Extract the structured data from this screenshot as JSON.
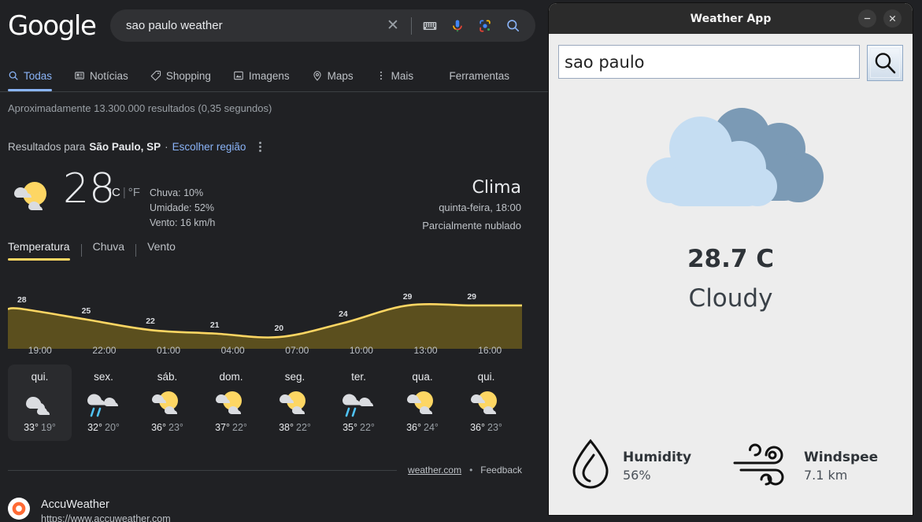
{
  "google": {
    "logo": "Google",
    "search": {
      "query": "sao paulo weather",
      "clear_icon": "close-icon"
    },
    "search_icons": [
      "keyboard-icon",
      "microphone-icon",
      "google-lens-icon",
      "search-icon"
    ],
    "nav": [
      {
        "label": "Todas",
        "icon": "search-icon",
        "active": true
      },
      {
        "label": "Notícias",
        "icon": "news-icon",
        "active": false
      },
      {
        "label": "Shopping",
        "icon": "tag-icon",
        "active": false
      },
      {
        "label": "Imagens",
        "icon": "image-icon",
        "active": false
      },
      {
        "label": "Maps",
        "icon": "map-pin-icon",
        "active": false
      },
      {
        "label": "Mais",
        "icon": "more-vertical-icon",
        "active": false
      }
    ],
    "tools_label": "Ferramentas",
    "result_stats": "Aproximadamente 13.300.000 resultados (0,35 segundos)",
    "region": {
      "prefix": "Resultados para",
      "location": "São Paulo, SP",
      "separator": "·",
      "change_link": "Escolher região"
    },
    "weather_card": {
      "temperature": "28",
      "unit_c": "°C",
      "unit_f": "°F",
      "details": [
        "Chuva: 10%",
        "Umidade: 52%",
        "Vento: 16 km/h"
      ],
      "title": "Clima",
      "datetime": "quinta-feira, 18:00",
      "condition": "Parcialmente nublado",
      "tabs": [
        {
          "label": "Temperatura",
          "active": true
        },
        {
          "label": "Chuva",
          "active": false
        },
        {
          "label": "Vento",
          "active": false
        }
      ],
      "days": [
        {
          "name": "qui.",
          "icon": "cloudy-icon",
          "high": "33°",
          "low": "19°",
          "selected": true
        },
        {
          "name": "sex.",
          "icon": "rain-cloud-icon",
          "high": "32°",
          "low": "20°",
          "selected": false
        },
        {
          "name": "sáb.",
          "icon": "partly-cloudy-icon",
          "high": "36°",
          "low": "23°",
          "selected": false
        },
        {
          "name": "dom.",
          "icon": "partly-cloudy-icon",
          "high": "37°",
          "low": "22°",
          "selected": false
        },
        {
          "name": "seg.",
          "icon": "partly-cloudy-icon",
          "high": "38°",
          "low": "22°",
          "selected": false
        },
        {
          "name": "ter.",
          "icon": "rain-cloud-icon",
          "high": "35°",
          "low": "22°",
          "selected": false
        },
        {
          "name": "qua.",
          "icon": "partly-cloudy-icon",
          "high": "36°",
          "low": "24°",
          "selected": false
        },
        {
          "name": "qui.",
          "icon": "partly-cloudy-icon",
          "high": "36°",
          "low": "23°",
          "selected": false
        }
      ],
      "source_link": "weather.com",
      "source_dot": "•",
      "feedback": "Feedback"
    },
    "organic_result": {
      "title": "AccuWeather",
      "url": "https://www.accuweather.com"
    }
  },
  "chart_data": {
    "type": "line",
    "title": "Temperatura",
    "xlabel": "",
    "ylabel": "",
    "categories": [
      "19:00",
      "22:00",
      "01:00",
      "04:00",
      "07:00",
      "10:00",
      "13:00",
      "16:00"
    ],
    "x_tick_labels": [
      "19:00",
      "22:00",
      "01:00",
      "04:00",
      "07:00",
      "10:00",
      "13:00",
      "16:00"
    ],
    "point_labels": [
      "28",
      "25",
      "22",
      "21",
      "20",
      "24",
      "29",
      "29"
    ],
    "values": [
      28,
      25,
      22,
      21,
      20,
      24,
      29,
      29
    ],
    "ylim": [
      18,
      31
    ],
    "grid": false,
    "legend": "none",
    "line_color": "#fdd663",
    "fill_color": "#5b4f1e",
    "label_color": "#dadce0"
  },
  "weather_app": {
    "title": "Weather App",
    "minimize_icon": "minimize-icon",
    "close_icon": "close-icon",
    "search_value": "sao paulo",
    "search_button_icon": "magnifier-icon",
    "illustration_icon": "double-cloud-icon",
    "temperature": "28.7 C",
    "condition": "Cloudy",
    "humidity": {
      "icon": "water-drop-icon",
      "label": "Humidity",
      "value": "56%"
    },
    "wind": {
      "icon": "wind-icon",
      "label": "Windspee",
      "value": "7.1 km"
    },
    "colors": {
      "cloud_front": "#c5ddf2",
      "cloud_back": "#7b9ab5",
      "window_bg": "#ededed",
      "titlebar": "#2b2b2b"
    }
  }
}
